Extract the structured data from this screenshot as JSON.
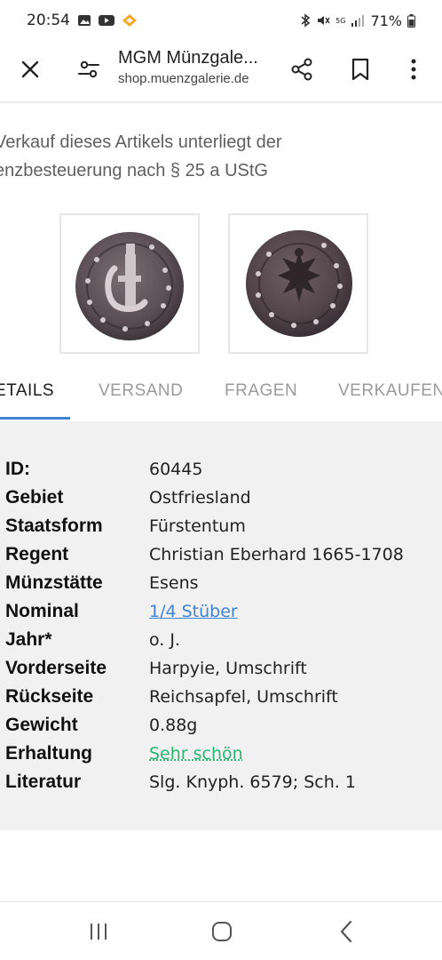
{
  "status_bar": {
    "time": "20:54",
    "battery": "71%",
    "network": "5G"
  },
  "browser": {
    "title": "MGM Münzgale...",
    "url": "shop.muenzgalerie.de"
  },
  "notice": {
    "line1": "Verkauf dieses Artikels unterliegt der",
    "line2": "enzbesteuerung nach § 25 a UStG"
  },
  "tabs": [
    {
      "label": "ETAILS"
    },
    {
      "label": "VERSAND"
    },
    {
      "label": "FRAGEN"
    },
    {
      "label": "VERKAUFEN"
    }
  ],
  "details": [
    {
      "key": "ID:",
      "value": "60445"
    },
    {
      "key": "Gebiet",
      "value": "Ostfriesland"
    },
    {
      "key": "Staatsform",
      "value": "Fürstentum"
    },
    {
      "key": "Regent",
      "value": "Christian Eberhard 1665-1708"
    },
    {
      "key": "Münzstätte",
      "value": "Esens"
    },
    {
      "key": "Nominal",
      "value": "1/4 Stüber"
    },
    {
      "key": "Jahr*",
      "value": "o. J."
    },
    {
      "key": "Vorderseite",
      "value": "Harpyie, Umschrift"
    },
    {
      "key": "Rückseite",
      "value": "Reichsapfel, Umschrift"
    },
    {
      "key": "Gewicht",
      "value": "0.88g"
    },
    {
      "key": "Erhaltung",
      "value": "Sehr schön"
    },
    {
      "key": "Literatur",
      "value": "Slg. Knyph. 6579; Sch. 1"
    }
  ],
  "colors": {
    "accent": "#3f83d1",
    "condition_link": "#2bb673",
    "panel_bg": "#f1f1f1"
  }
}
